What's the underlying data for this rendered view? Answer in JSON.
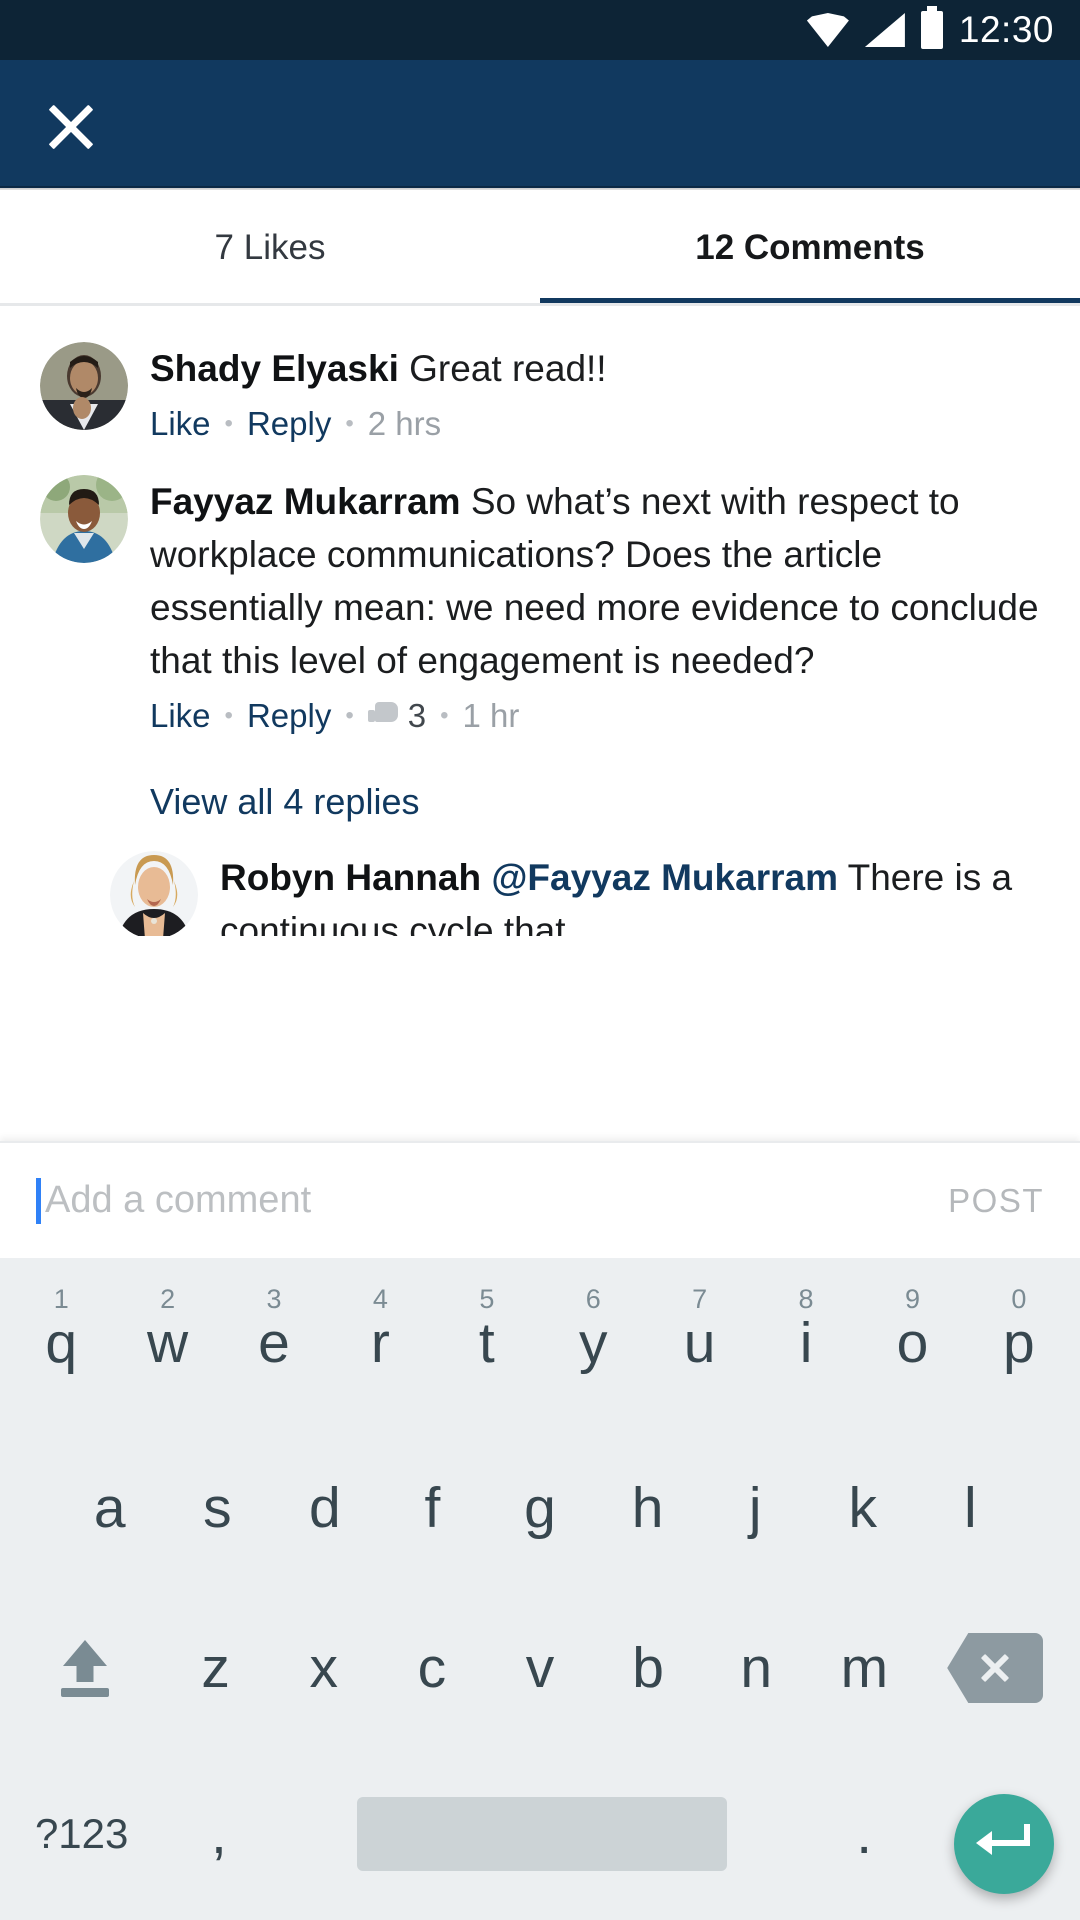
{
  "status_bar": {
    "time": "12:30",
    "icons": [
      "wifi-icon",
      "cell-signal-icon",
      "battery-icon"
    ]
  },
  "app_bar": {
    "close_icon": "close-icon"
  },
  "tabs": [
    {
      "label": "7 Likes",
      "active": false
    },
    {
      "label": "12 Comments",
      "active": true
    }
  ],
  "comments": [
    {
      "author": "Shady Elyaski",
      "text": " Great read!!",
      "like_label": "Like",
      "reply_label": "Reply",
      "time": "2 hrs"
    },
    {
      "author": "Fayyaz Mukarram",
      "text": " So what’s next with respect to workplace communications? Does the article essentially mean: we need more evidence to conclude that this level of engagement is needed?",
      "like_label": "Like",
      "reply_label": "Reply",
      "likes_count": "3",
      "time": "1 hr"
    }
  ],
  "view_replies_label": "View all 4 replies",
  "reply": {
    "author": "Robyn Hannah",
    "mention": " @Fayyaz Mukarram",
    "text": "There is a continuous cycle that"
  },
  "input_bar": {
    "placeholder": "Add a comment",
    "value": "",
    "post_label": "POST"
  },
  "keyboard": {
    "row1": [
      {
        "key": "q",
        "num": "1"
      },
      {
        "key": "w",
        "num": "2"
      },
      {
        "key": "e",
        "num": "3"
      },
      {
        "key": "r",
        "num": "4"
      },
      {
        "key": "t",
        "num": "5"
      },
      {
        "key": "y",
        "num": "6"
      },
      {
        "key": "u",
        "num": "7"
      },
      {
        "key": "i",
        "num": "8"
      },
      {
        "key": "o",
        "num": "9"
      },
      {
        "key": "p",
        "num": "0"
      }
    ],
    "row2": [
      "a",
      "s",
      "d",
      "f",
      "g",
      "h",
      "j",
      "k",
      "l"
    ],
    "row3": [
      "z",
      "x",
      "c",
      "v",
      "b",
      "n",
      "m"
    ],
    "shift_icon": "shift-icon",
    "backspace_icon": "backspace-icon",
    "symbols_label": "?123",
    "comma_label": ",",
    "period_label": ".",
    "enter_icon": "enter-icon"
  },
  "colors": {
    "status_bar_bg": "#0d2436",
    "app_bar_bg": "#11395f",
    "accent_link": "#11395f",
    "tab_underline": "#11395f",
    "keyboard_bg": "#eceff1",
    "enter_button_bg": "#3aa99a",
    "caret": "#2f81f7"
  }
}
